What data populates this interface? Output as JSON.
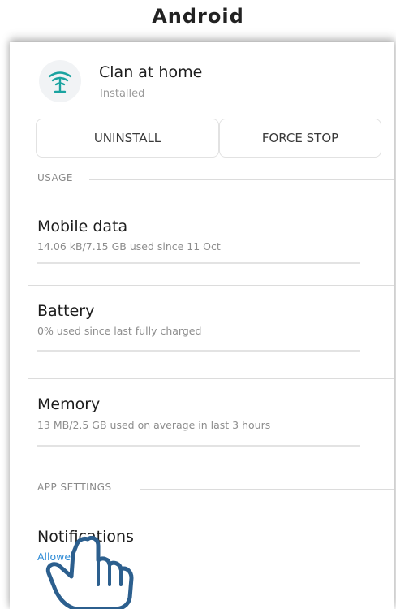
{
  "page": {
    "title": "Android"
  },
  "app": {
    "name": "Clan at home",
    "status": "Installed",
    "icon": "wifi-antenna-icon"
  },
  "buttons": {
    "uninstall": "UNINSTALL",
    "force_stop": "FORCE STOP"
  },
  "sections": {
    "usage": "USAGE",
    "app_settings": "APP SETTINGS"
  },
  "usage_rows": {
    "mobile_data": {
      "title": "Mobile data",
      "subtitle": "14.06 kB/7.15 GB used since 11 Oct"
    },
    "battery": {
      "title": "Battery",
      "subtitle": "0% used since last fully charged"
    },
    "memory": {
      "title": "Memory",
      "subtitle": "13 MB/2.5 GB used on average in last 3 hours"
    }
  },
  "settings_rows": {
    "notifications": {
      "title": "Notifications",
      "subtitle": "Allowed"
    }
  },
  "overlay": {
    "cursor": "pointing-hand-icon"
  },
  "colors": {
    "accent": "#2e8bd6",
    "icon": "#1aa3a0"
  }
}
